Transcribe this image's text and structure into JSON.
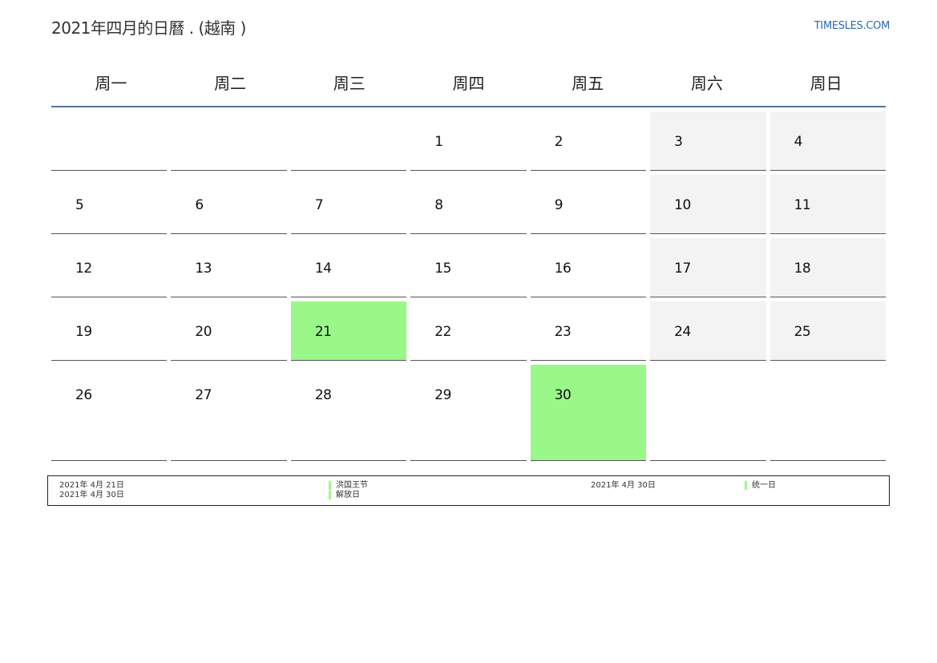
{
  "title": "2021年四月的日曆 . (越南 )",
  "site": "TIMESLES.COM",
  "weekdays": [
    "周一",
    "周二",
    "周三",
    "周四",
    "周五",
    "周六",
    "周日"
  ],
  "weeks": [
    [
      "",
      "",
      "",
      "1",
      "2",
      "3",
      "4"
    ],
    [
      "5",
      "6",
      "7",
      "8",
      "9",
      "10",
      "11"
    ],
    [
      "12",
      "13",
      "14",
      "15",
      "16",
      "17",
      "18"
    ],
    [
      "19",
      "20",
      "21",
      "22",
      "23",
      "24",
      "25"
    ],
    [
      "26",
      "27",
      "28",
      "29",
      "30",
      "",
      ""
    ]
  ],
  "highlighted_days": [
    "21",
    "30"
  ],
  "holiday_color": "#99f887",
  "weekend_color": "#f3f3f3",
  "legend": [
    {
      "date": "2021年 4月 21日",
      "name": "洪国王节"
    },
    {
      "date": "2021年 4月 30日",
      "name": "解放日"
    },
    {
      "date": "2021年 4月 30日",
      "name": "统一日"
    }
  ]
}
